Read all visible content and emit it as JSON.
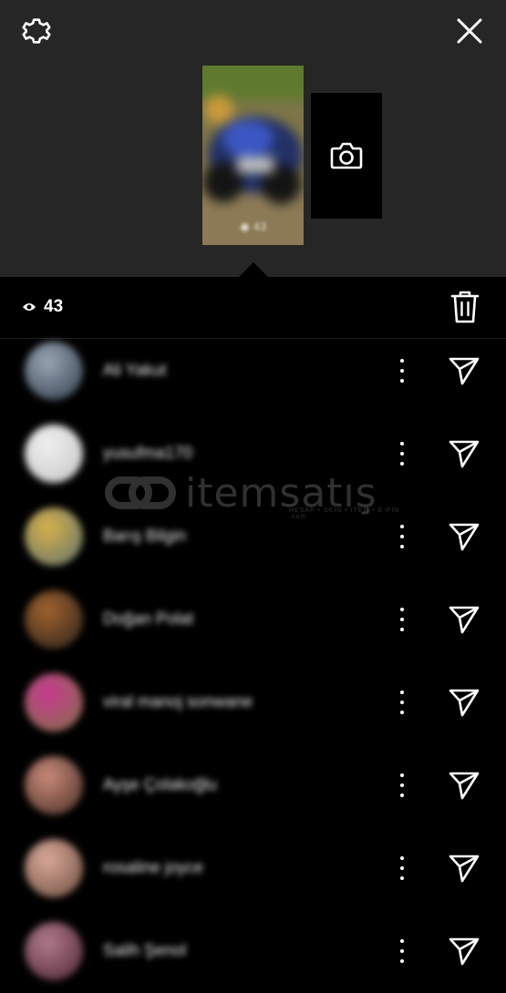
{
  "top_bar": {
    "settings_icon": "gear-icon",
    "close_icon": "close-icon"
  },
  "story": {
    "thumbnail_views_text": "43",
    "add_story_icon": "camera-icon"
  },
  "stats": {
    "views_icon": "eye-icon",
    "views_count": "43",
    "delete_icon": "trash-icon"
  },
  "viewers": [
    {
      "name": "Ali Yakut",
      "avatar_colors": [
        "#9aa6b4",
        "#3e4a5a"
      ]
    },
    {
      "name": "yusufma170",
      "avatar_colors": [
        "#f0f0f0",
        "#c9c9c9"
      ]
    },
    {
      "name": "Barış Bilgin",
      "avatar_colors": [
        "#d6b04a",
        "#6f7a6a"
      ]
    },
    {
      "name": "Doğan Polat",
      "avatar_colors": [
        "#a0622e",
        "#3a2a1e"
      ]
    },
    {
      "name": "viral manoj sonwane",
      "avatar_colors": [
        "#c73a8f",
        "#8a6a50"
      ]
    },
    {
      "name": "Ayşe Çolakoğlu",
      "avatar_colors": [
        "#c98a78",
        "#5a3a32"
      ]
    },
    {
      "name": "rosaline joyce",
      "avatar_colors": [
        "#d9a89a",
        "#7a5a4a"
      ]
    },
    {
      "name": "Salih Şenol",
      "avatar_colors": [
        "#b07a8c",
        "#5a3040"
      ]
    }
  ],
  "row_icons": {
    "more": "more-vertical-icon",
    "send": "send-icon"
  },
  "watermark": {
    "text": "itemsatış",
    "subtext": "HESAP • SKIN • ITEM • E-PIN .com"
  }
}
